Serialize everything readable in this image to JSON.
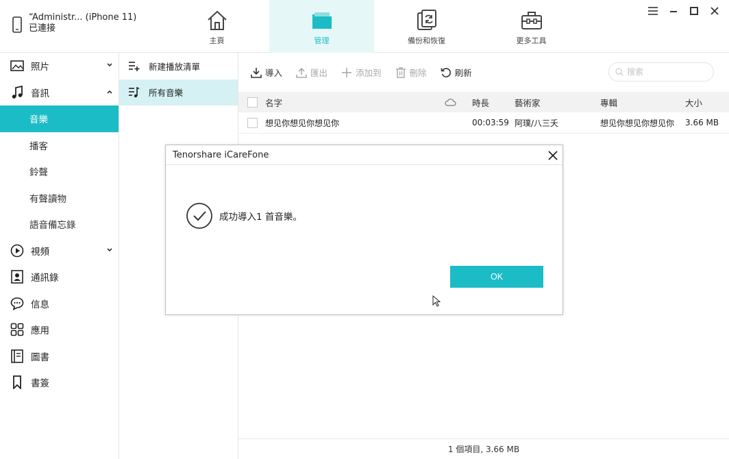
{
  "device": {
    "name": "“Administr... (iPhone 11)",
    "status": "已連接"
  },
  "nav": [
    {
      "label": "主頁",
      "icon": "home-icon"
    },
    {
      "label": "管理",
      "icon": "folder-icon",
      "active": true
    },
    {
      "label": "備份和恢復",
      "icon": "backup-restore-icon"
    },
    {
      "label": "更多工具",
      "icon": "toolbox-icon"
    }
  ],
  "sidebar": {
    "photos": "照片",
    "audio": "音訊",
    "music": "音樂",
    "podcasts": "播客",
    "ringtones": "鈴聲",
    "audiobooks": "有聲讀物",
    "voice_memos": "語音備忘錄",
    "video": "視頻",
    "contacts": "通訊錄",
    "messages": "信息",
    "apps": "應用",
    "books": "圖書",
    "bookmarks": "書簽"
  },
  "playlists": {
    "new": "新建播放清單",
    "all": "所有音樂"
  },
  "toolbar": {
    "import": "導入",
    "export": "匯出",
    "add_to": "添加到",
    "delete": "刪除",
    "refresh": "刷新",
    "search_placeholder": "搜索"
  },
  "table": {
    "headers": {
      "name": "名字",
      "duration": "時長",
      "artist": "藝術家",
      "album": "專輯",
      "size": "大小"
    },
    "rows": [
      {
        "name": "想见你想见你想见你",
        "duration": "00:03:59",
        "artist": "阿璞/八三夭",
        "album": "想见你想见你想见你",
        "size": "3.66 MB"
      }
    ]
  },
  "status": "1 個項目, 3.66 MB",
  "dialog": {
    "title": "Tenorshare iCareFone",
    "message": "成功導入1 首音樂。",
    "ok": "OK"
  },
  "colors": {
    "accent": "#1cbcc6",
    "active_nav_bg": "#e6f7f8"
  }
}
